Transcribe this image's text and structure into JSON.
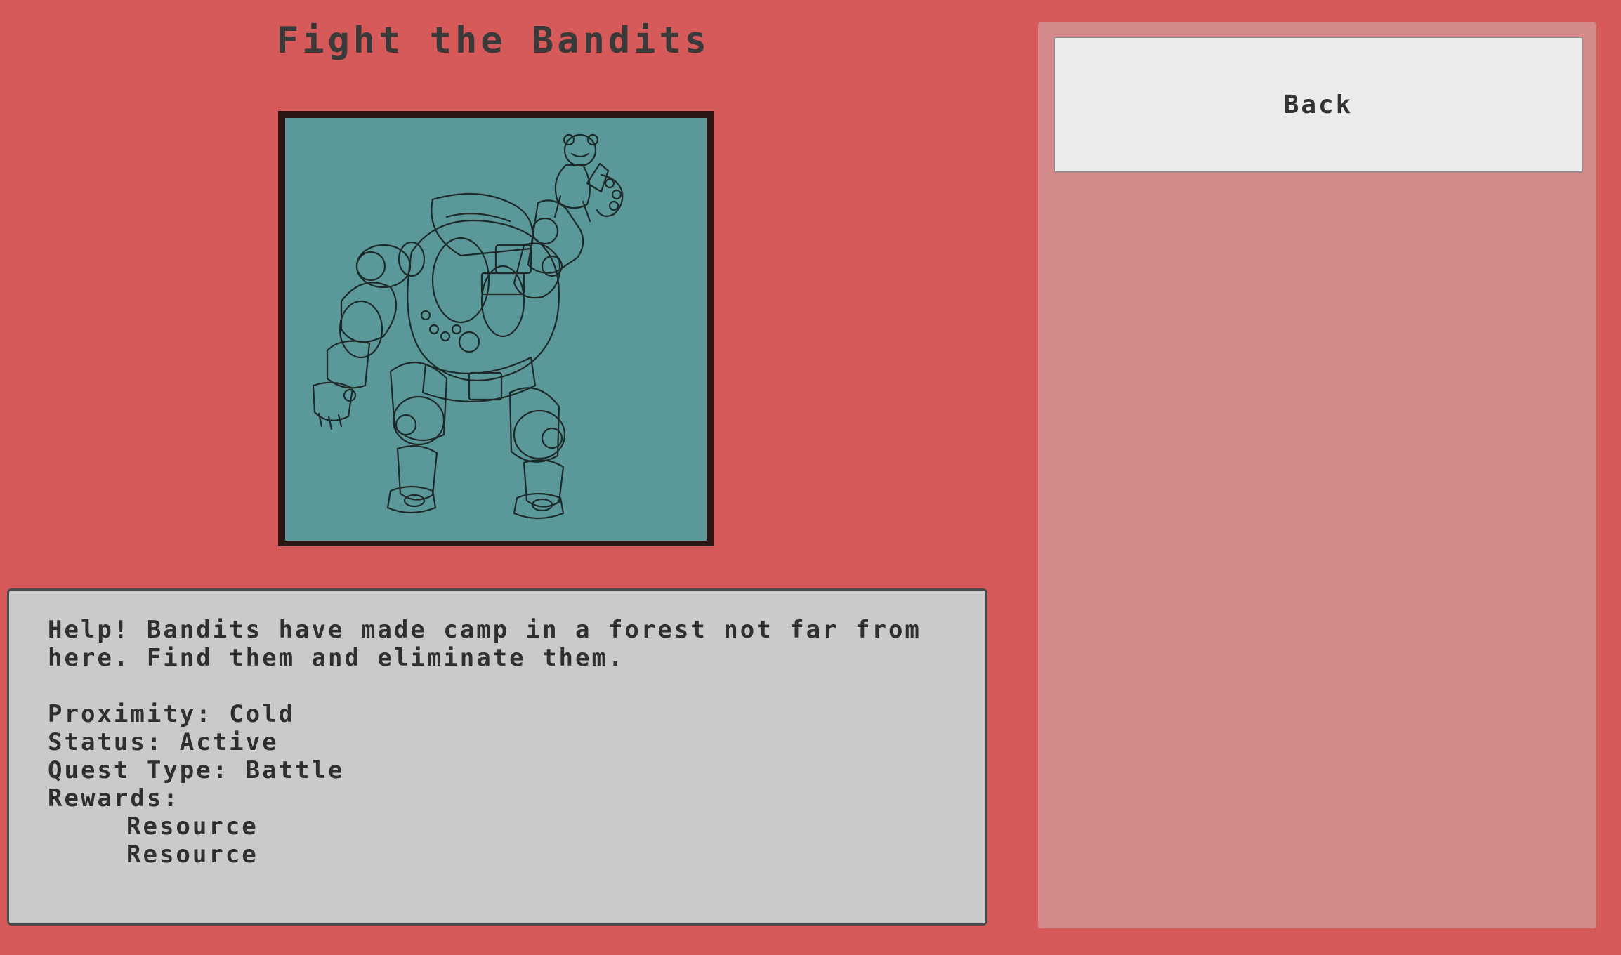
{
  "quest": {
    "title": "Fight the Bandits",
    "description": "Help! Bandits have made camp in a forest not far from here. Find them and eliminate them.",
    "proximity": "Proximity: Cold",
    "status": "Status: Active",
    "quest_type": "Quest Type: Battle",
    "rewards_label": "Rewards:",
    "rewards": [
      "Resource",
      "Resource"
    ]
  },
  "sidebar": {
    "back_label": "Back"
  },
  "colors": {
    "background": "#d65a5a",
    "portrait_bg": "#5a9899",
    "panel": "#cacaca",
    "sidebar": "#d48a8a"
  },
  "icons": {
    "portrait": "mech-warrior-illustration"
  }
}
